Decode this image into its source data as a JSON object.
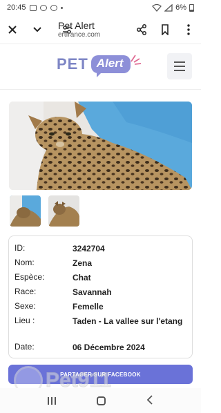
{
  "status_bar": {
    "time": "20:45",
    "battery": "6%"
  },
  "browser": {
    "title": "Pet Alert",
    "url": "ertfrance.com"
  },
  "site": {
    "logo_pet": "PET",
    "logo_alert": "Alert"
  },
  "pet": {
    "rows": [
      {
        "label": "ID:",
        "value": "3242704"
      },
      {
        "label": "Nom:",
        "value": "Zena"
      },
      {
        "label": "Espèce:",
        "value": "Chat"
      },
      {
        "label": "Race:",
        "value": "Savannah"
      },
      {
        "label": "Sexe:",
        "value": "Femelle"
      },
      {
        "label": "Lieu :",
        "value": "Taden -  La vallee sur l'etang"
      },
      {
        "label": "Date:",
        "value": "06 Décembre 2024"
      }
    ]
  },
  "share_button": "PARTAGER SUR FACEBOOK",
  "watermark": "Pet911",
  "colors": {
    "brand": "#8d8fd8",
    "button": "#6a72d8"
  }
}
